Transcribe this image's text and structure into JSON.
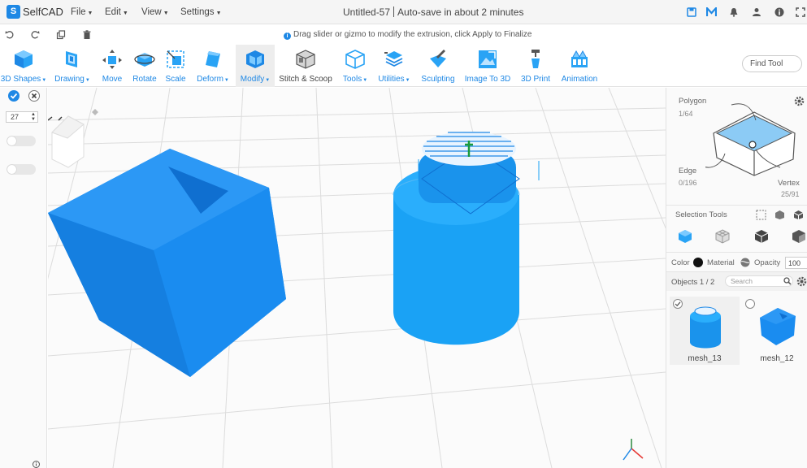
{
  "app": {
    "name": "SelfCAD"
  },
  "menu": [
    {
      "label": "File"
    },
    {
      "label": "Edit"
    },
    {
      "label": "View"
    },
    {
      "label": "Settings"
    }
  ],
  "document": {
    "title": "Untitled-57",
    "autosave": "Auto-save in about 2 minutes"
  },
  "hint": "Drag slider or gizmo to modify the extrusion, click Apply to Finalize",
  "toolbar": [
    {
      "label": "3D Shapes",
      "dropdown": true,
      "icon": "cube-icon"
    },
    {
      "label": "Drawing",
      "dropdown": true,
      "icon": "drawing-icon"
    },
    {
      "label": "Move",
      "dropdown": false,
      "icon": "move-icon"
    },
    {
      "label": "Rotate",
      "dropdown": false,
      "icon": "rotate-icon"
    },
    {
      "label": "Scale",
      "dropdown": false,
      "icon": "scale-icon"
    },
    {
      "label": "Deform",
      "dropdown": true,
      "icon": "deform-icon"
    },
    {
      "label": "Modify",
      "dropdown": true,
      "icon": "modify-icon",
      "active": true
    },
    {
      "label": "Stitch & Scoop",
      "dropdown": false,
      "icon": "stitch-scoop-icon"
    },
    {
      "label": "Tools",
      "dropdown": true,
      "icon": "tools-icon"
    },
    {
      "label": "Utilities",
      "dropdown": true,
      "icon": "utilities-icon"
    },
    {
      "label": "Sculpting",
      "dropdown": false,
      "icon": "sculpting-icon"
    },
    {
      "label": "Image To 3D",
      "dropdown": false,
      "icon": "image-to-3d-icon"
    },
    {
      "label": "3D Print",
      "dropdown": false,
      "icon": "3d-print-icon"
    },
    {
      "label": "Animation",
      "dropdown": false,
      "icon": "animation-icon"
    }
  ],
  "find_tool": {
    "placeholder": "Find Tool"
  },
  "left_panel": {
    "value": "27"
  },
  "right_panel": {
    "polygon": {
      "label": "Polygon",
      "count": "1/64"
    },
    "edge": {
      "label": "Edge",
      "count": "0/196"
    },
    "vertex": {
      "label": "Vertex",
      "count": "25/91"
    },
    "selection_tools_label": "Selection Tools",
    "color_label": "Color",
    "material_label": "Material",
    "opacity_label": "Opacity",
    "opacity_value": "100",
    "objects_label": "Objects 1 / 2",
    "search_placeholder": "Search",
    "objects": [
      {
        "name": "mesh_13",
        "selected": true
      },
      {
        "name": "mesh_12",
        "selected": false
      }
    ]
  },
  "colors": {
    "accent": "#1e88e5",
    "mesh": "#1a8cf0",
    "mesh_dark": "#0f6fd0"
  }
}
